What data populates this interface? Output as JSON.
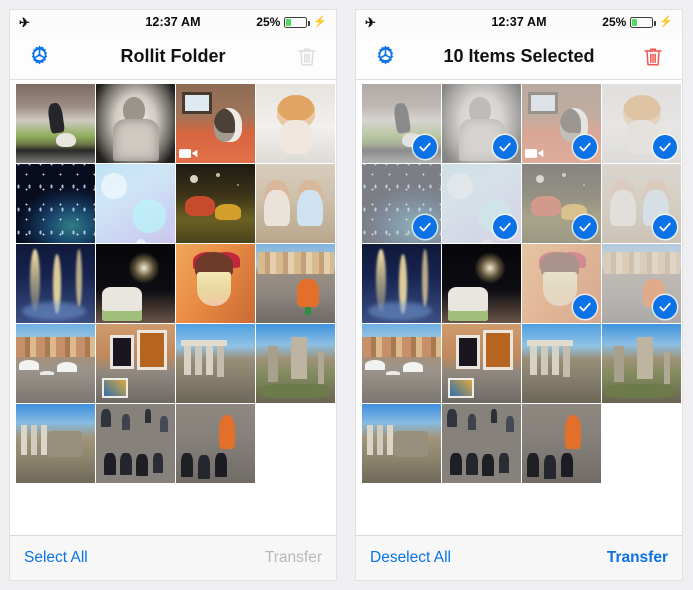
{
  "app": {
    "accent_blue": "#0b72e7",
    "danger_red": "#f2564f",
    "disabled_gray": "#b9b9bd",
    "battery_green": "#4cd964"
  },
  "status_bar": {
    "airplane_icon": "airplane-mode-icon",
    "time": "12:37 AM",
    "battery_percent": "25%",
    "battery_level": 25,
    "charging_icon": "lightning-bolt-icon"
  },
  "panels": [
    {
      "id": "browse",
      "nav": {
        "settings_icon": "gear-icon",
        "title": "Rollit Folder",
        "trash_icon": "trash-icon",
        "trash_enabled": false
      },
      "toolbar": {
        "left_label": "Select All",
        "right_label": "Transfer",
        "right_enabled": false
      },
      "selected_count": 0,
      "selected_indices": []
    },
    {
      "id": "selection",
      "nav": {
        "settings_icon": "gear-icon",
        "title": "10 Items Selected",
        "trash_icon": "trash-icon",
        "trash_enabled": true
      },
      "toolbar": {
        "left_label": "Deselect All",
        "right_label": "Transfer",
        "right_enabled": true
      },
      "selected_count": 10,
      "selected_indices": [
        0,
        1,
        2,
        3,
        4,
        5,
        6,
        7,
        10,
        11
      ]
    }
  ],
  "grid": {
    "columns": 4,
    "rows": 5,
    "total_items": 19,
    "items": [
      {
        "name": "cat-at-wall-photo",
        "art": "p-catwall",
        "is_video": false
      },
      {
        "name": "vintage-portrait-photo",
        "art": "p-portrait",
        "is_video": false
      },
      {
        "name": "husky-on-couch-video",
        "art": "p-husky",
        "is_video": true
      },
      {
        "name": "orange-kitten-photo",
        "art": "p-kitten",
        "is_video": false
      },
      {
        "name": "galaxy-wallpaper-photo",
        "art": "p-galaxy",
        "is_video": false
      },
      {
        "name": "bokeh-wallpaper-photo",
        "art": "p-bokeh",
        "is_video": false
      },
      {
        "name": "night-park-photo",
        "art": "p-night",
        "is_video": false
      },
      {
        "name": "two-children-photo",
        "art": "p-kids",
        "is_video": false
      },
      {
        "name": "lit-fountain-photo",
        "art": "p-fountain",
        "is_video": false
      },
      {
        "name": "fireworks-photo",
        "art": "p-fireworks",
        "is_video": false
      },
      {
        "name": "dessert-parfait-photo",
        "art": "p-parfait",
        "is_video": false
      },
      {
        "name": "piazza-statue-photo",
        "art": "p-piazza",
        "is_video": false
      },
      {
        "name": "piazza-navona-photo",
        "art": "p-square",
        "is_video": false
      },
      {
        "name": "street-art-stall-photo",
        "art": "p-art",
        "is_video": false
      },
      {
        "name": "roman-forum-columns-photo",
        "art": "p-forum",
        "is_video": false
      },
      {
        "name": "roman-ruins-photo",
        "art": "p-ruins",
        "is_video": false
      },
      {
        "name": "forum-overlook-photo",
        "art": "p-forum2",
        "is_video": false
      },
      {
        "name": "group-in-suits-photo",
        "art": "p-crowd",
        "is_video": false
      },
      {
        "name": "street-performer-photo",
        "art": "p-crowd2",
        "is_video": false
      }
    ]
  }
}
